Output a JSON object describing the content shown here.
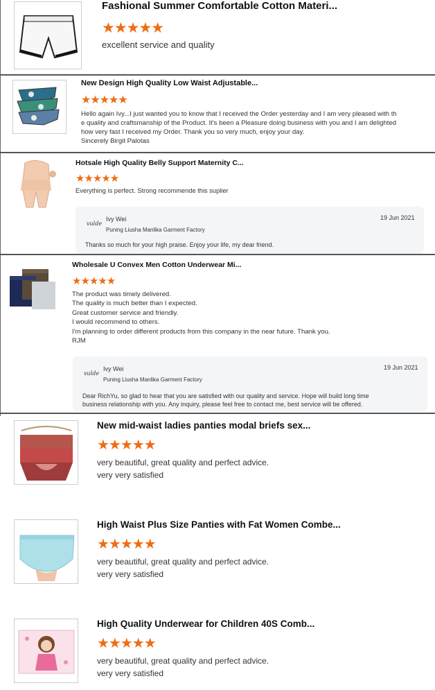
{
  "reviews": [
    {
      "title": "Fashional Summer Comfortable Cotton Materi...",
      "rating": 5,
      "stars": "★★★★★",
      "comment": "excellent service and quality",
      "thumb_icon": "white-shorts-image"
    },
    {
      "title": "New Design High Quality Low Waist Adjustable...",
      "rating": 5,
      "stars": "★★★★★",
      "comment": "Hello again Ivy...I just wanted you to know that I received the Order yesterday and I am very pleased with th\ne quality and craftsmanship of the Product. It's been a Pleasure doing business with you and I am delighted\nhow very fast I received my Order. Thank you so very much, enjoy your day.\nSincerely Birgit Palotas",
      "thumb_icon": "printed-briefs-image"
    },
    {
      "title": "Hotsale High Quality Belly Support Maternity C...",
      "rating": 5,
      "stars": "★★★★★",
      "comment": "Everything is perfect. Strong recommende this suplier",
      "thumb_icon": "maternity-shorts-image",
      "reply": {
        "logo": "vulde",
        "name": "Ivy Wei",
        "company": "Puning Liusha Manlika Garment Factory",
        "date": "19 Jun 2021",
        "message": "Thanks so much for your high praise. Enjoy your life, my dear friend."
      }
    },
    {
      "title": "Wholesale U Convex Men Cotton Underwear Mi...",
      "rating": 5,
      "stars": "★★★★★",
      "comment": "The product was timely delivered.\nThe quality is much better than I expected.\nGreat customer service and friendly.\nI would recommend to others.\nI'm planning to order different products from this company in the near future. Thank you.\nRJM",
      "thumb_icon": "men-boxers-image",
      "reply": {
        "logo": "vulde",
        "name": "Ivy Wei",
        "company": "Puning Liusha Manlika Garment Factory",
        "date": "19 Jun 2021",
        "message": "Dear  RichYu, so glad to hear that you are satisfied with our quality and service. Hope will build long time\nbusiness relationship with you. Any inquiry, please feel free to contact me, best service will be offered."
      }
    },
    {
      "title": "New mid-waist ladies panties modal briefs sex...",
      "rating": 5,
      "stars": "★★★★★",
      "comment": "very beautiful, great quality and perfect advice.\nvery very satisfied",
      "thumb_icon": "hanging-panties-image"
    },
    {
      "title": "High Waist Plus Size Panties with Fat Women Combe...",
      "rating": 5,
      "stars": "★★★★★",
      "comment": "very beautiful, great quality and perfect advice.\nvery very satisfied",
      "thumb_icon": "high-waist-panties-image"
    },
    {
      "title": "High Quality Underwear for Children 40S Comb...",
      "rating": 5,
      "stars": "★★★★★",
      "comment": "very beautiful, great quality and perfect advice.\nvery very satisfied",
      "thumb_icon": "kids-underwear-image"
    }
  ],
  "colors": {
    "star": "#ef6c12",
    "reply_bg": "#f4f5f7",
    "separator": "#555555"
  }
}
